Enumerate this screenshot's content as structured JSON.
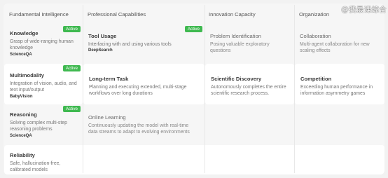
{
  "headers": [
    "Fundamental Intelligence",
    "Professional Capabilities",
    "Innovation Capacity",
    "Organization"
  ],
  "watermark": "@我最课综合",
  "cells": {
    "knowledge": {
      "title": "Knowledge",
      "desc": "Grasp of wide-ranging human knowledge",
      "bench": "ScienceQA",
      "badge": "Active"
    },
    "tool_usage": {
      "title": "Tool Usage",
      "desc": "Interfacing with and using various tools",
      "bench": "DeepSearch",
      "badge": "Active"
    },
    "problem_id": {
      "title": "Problem Identification",
      "desc": "Posing valuable exploratory questions"
    },
    "collaboration": {
      "title": "Collaboration",
      "desc": "Multi-agent collaboration for new scaling effects"
    },
    "multimodality": {
      "title": "Multimodality",
      "desc": "Integration of vision, audio, and text input/output",
      "bench": "BabyVision",
      "badge": "Active"
    },
    "long_term": {
      "title": "Long-term Task",
      "desc": "Planning and executing extended, multi-stage workflows over long durations"
    },
    "sci_discovery": {
      "title": "Scientific Discovery",
      "desc": "Autonomously completes the entire scientific research process."
    },
    "competition": {
      "title": "Competition",
      "desc": "Exceeding human performance in information asymmetry games"
    },
    "reasoning": {
      "title": "Reasoning",
      "desc": "Solving complex multi-step reasoning problems",
      "bench": "ScienceQA",
      "badge": "Active"
    },
    "online_learning": {
      "title": "Online Learning",
      "desc": "Continuously updating the model with real-time data streams to adapt to evolving environments"
    },
    "reliability": {
      "title": "Reliability",
      "desc": "Safe, hallucination-free, calibrated models"
    }
  }
}
